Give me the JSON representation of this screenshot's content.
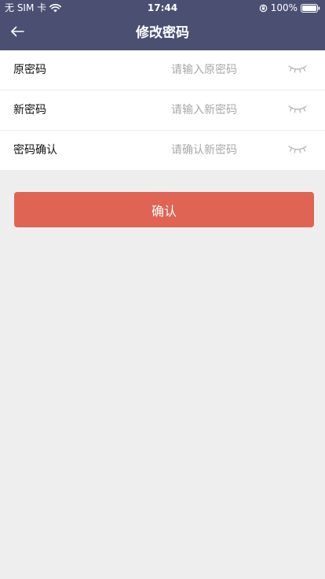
{
  "status_bar": {
    "carrier": "无 SIM 卡",
    "time": "17:44",
    "battery_percent": "100%",
    "battery_level": 1.0
  },
  "nav": {
    "title": "修改密码",
    "back_icon": "back-arrow-icon"
  },
  "form": {
    "fields": [
      {
        "label": "原密码",
        "placeholder": "请输入原密码",
        "value": "",
        "toggle_icon": "eye-closed-icon"
      },
      {
        "label": "新密码",
        "placeholder": "请输入新密码",
        "value": "",
        "toggle_icon": "eye-closed-icon"
      },
      {
        "label": "密码确认",
        "placeholder": "请确认新密码",
        "value": "",
        "toggle_icon": "eye-closed-icon"
      }
    ]
  },
  "actions": {
    "confirm_label": "确认"
  },
  "colors": {
    "header_bg": "#4b5073",
    "accent": "#e06453",
    "page_bg": "#eeeeee",
    "placeholder": "#a8a8a8"
  }
}
